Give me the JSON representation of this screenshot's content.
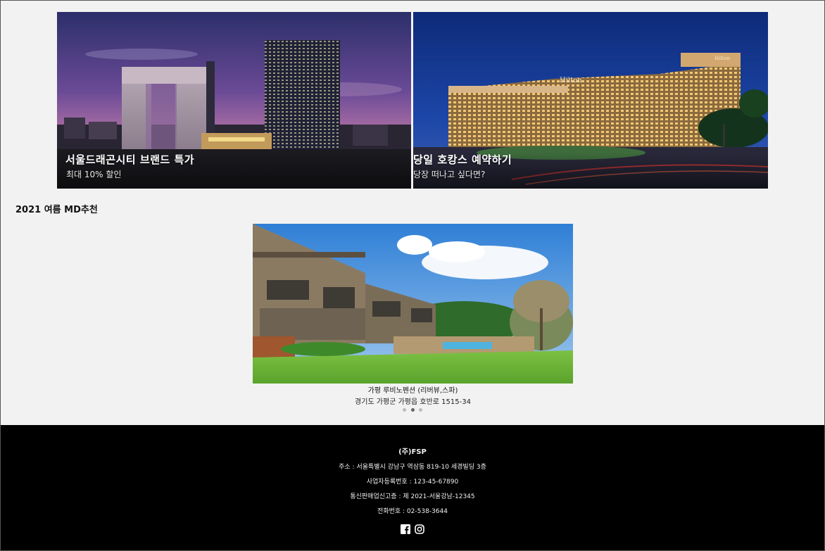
{
  "banners": [
    {
      "title": "서울드래곤시티 브랜드 특가",
      "subtitle": "최대 10% 할인"
    },
    {
      "title": "당일 호캉스 예약하기",
      "subtitle": "당장 떠나고 싶다면?",
      "sign_text": "Hilton"
    }
  ],
  "section": {
    "title": "2021 여름 MD추천"
  },
  "carousel": {
    "name": "가평 루비노펜션 (리버뷰,스파)",
    "address": "경기도 가평군 가평읍 호반로 1515-34",
    "slide_count": 3,
    "active_index": 1
  },
  "footer": {
    "company": "(주)FSP",
    "address": "주소 : 서울특별시 강남구 역삼동 819-10 세경빌딩 3층",
    "business_no": "사업자등록번호 : 123-45-67890",
    "mail_order": "통신판매업신고증 : 제 2021-서울강남-12345",
    "phone": "전화번호 : 02-538-3644",
    "social_icons": [
      "facebook-icon",
      "instagram-icon"
    ]
  },
  "colors": {
    "page_bg": "#f2f2f2",
    "footer_bg": "#000000"
  }
}
